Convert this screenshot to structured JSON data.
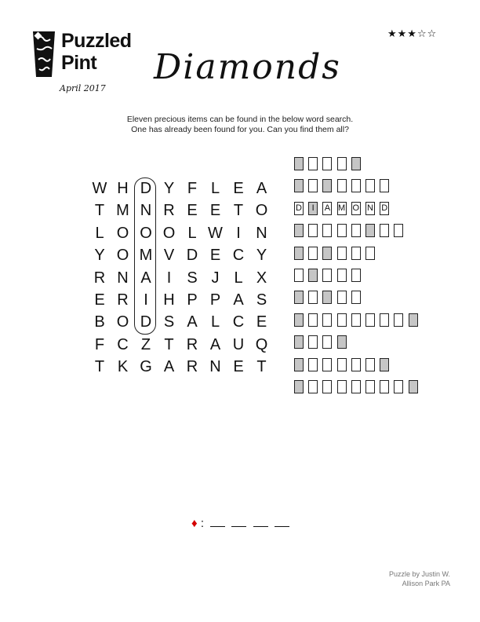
{
  "logo": {
    "line1": "Puzzled",
    "line2": "Pint",
    "date": "April 2017"
  },
  "difficulty": {
    "stars": "★★★☆☆",
    "filled": 3,
    "total": 5
  },
  "title": "Diamonds",
  "intro": [
    "Eleven precious items can be found in the below word search.",
    "One has already been found for you. Can you find them all?"
  ],
  "grid": [
    [
      "W",
      "H",
      "D",
      "Y",
      "F",
      "L",
      "E",
      "A"
    ],
    [
      "T",
      "M",
      "N",
      "R",
      "E",
      "E",
      "T",
      "O"
    ],
    [
      "L",
      "O",
      "O",
      "O",
      "L",
      "W",
      "I",
      "N"
    ],
    [
      "Y",
      "O",
      "M",
      "V",
      "D",
      "E",
      "C",
      "Y"
    ],
    [
      "R",
      "N",
      "A",
      "I",
      "S",
      "J",
      "L",
      "X"
    ],
    [
      "E",
      "R",
      "I",
      "H",
      "P",
      "P",
      "A",
      "S"
    ],
    [
      "B",
      "O",
      "D",
      "S",
      "A",
      "L",
      "C",
      "E"
    ],
    [
      "F",
      "C",
      "Z",
      "T",
      "R",
      "A",
      "U",
      "Q"
    ],
    [
      "T",
      "K",
      "G",
      "A",
      "R",
      "N",
      "E",
      "T"
    ]
  ],
  "answer_rows": [
    {
      "length": 5,
      "shaded": [
        1,
        5
      ],
      "letters": []
    },
    {
      "length": 7,
      "shaded": [
        1,
        3
      ],
      "letters": []
    },
    {
      "length": 7,
      "shaded": [
        2
      ],
      "letters": [
        "D",
        "I",
        "A",
        "M",
        "O",
        "N",
        "D"
      ]
    },
    {
      "length": 8,
      "shaded": [
        1,
        6
      ],
      "letters": []
    },
    {
      "length": 6,
      "shaded": [
        1,
        3
      ],
      "letters": []
    },
    {
      "length": 5,
      "shaded": [
        2
      ],
      "letters": []
    },
    {
      "length": 5,
      "shaded": [
        1,
        3
      ],
      "letters": []
    },
    {
      "length": 9,
      "shaded": [
        1,
        9
      ],
      "letters": []
    },
    {
      "length": 4,
      "shaded": [
        1,
        4
      ],
      "letters": []
    },
    {
      "length": 7,
      "shaded": [
        1,
        7
      ],
      "letters": []
    },
    {
      "length": 9,
      "shaded": [
        1,
        9
      ],
      "letters": []
    }
  ],
  "answer_line": {
    "symbol": "♦",
    "separator": ":",
    "blanks": 4
  },
  "credit": [
    "Puzzle by Justin W.",
    "Allison Park PA"
  ]
}
